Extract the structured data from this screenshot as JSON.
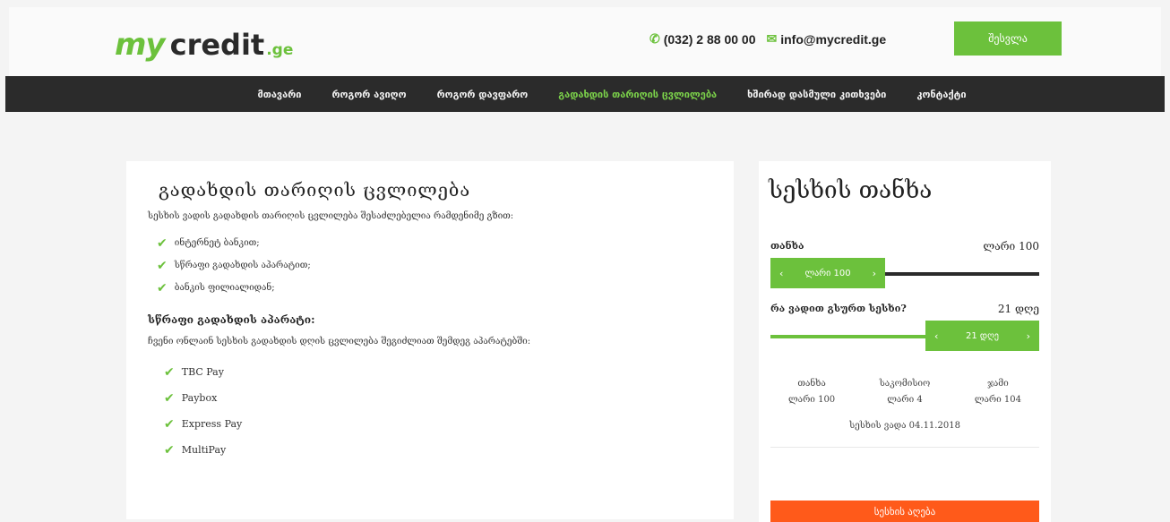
{
  "header": {
    "logo": {
      "my": "my",
      "credit": "credit",
      "ge": ".ge"
    },
    "phone": "(032) 2 88 00 00",
    "email": "info@mycredit.ge",
    "login_label": "შესვლა"
  },
  "nav": {
    "items": [
      {
        "label": "მთავარი",
        "active": false
      },
      {
        "label": "როგორ ავიღო",
        "active": false
      },
      {
        "label": "როგორ დავფარო",
        "active": false
      },
      {
        "label": "გადახდის თარიღის ცვლილება",
        "active": true
      },
      {
        "label": "ხშირად დასმული კითხვები",
        "active": false
      },
      {
        "label": "კონტაქტი",
        "active": false
      }
    ]
  },
  "main": {
    "title": "გადახდის თარიღის ცვლილება",
    "intro": "სესხის ვადის გადახდის თარიღის ცვლილება შესაძლებელია რამდენიმე გზით:",
    "methods": [
      "ინტერნეტ ბანკით;",
      "სწრაფი გადახდის აპარატით;",
      "ბანკის ფილიალიდან;"
    ],
    "terminals_title": "სწრაფი გადახდის აპარატი:",
    "terminals_intro": "ჩვენი ონლაინ სესხის გადახდის დღის ცვლილება შეგიძლიათ შემდეგ აპარატებში:",
    "terminals": [
      "TBC Pay",
      "Paybox",
      "Express Pay",
      "MultiPay"
    ]
  },
  "calculator": {
    "title": "სესხის თანხა",
    "amount_label": "თანხა",
    "amount_value": "ლარი 100",
    "amount_handle": "ლარი 100",
    "amount_fraction": 0.2,
    "term_label": "რა ვადით გსურთ სესხი?",
    "term_value": "21 დღე",
    "term_handle": "21 დღე",
    "term_fraction": 0.7,
    "summary": [
      {
        "label": "თანხა",
        "value": "ლარი 100"
      },
      {
        "label": "საკომისიო",
        "value": "ლარი 4"
      },
      {
        "label": "ჯამი",
        "value": "ლარი 104"
      }
    ],
    "due_date": "სესხის ვადა 04.11.2018",
    "submit_label": "სესხის აღება"
  },
  "colors": {
    "accent": "#6cc13c",
    "nav_bg": "#2b2b2b",
    "cta": "#ff5a1a"
  },
  "icons": {
    "phone": "phone-icon",
    "email": "envelope-icon",
    "check": "checkmark-icon"
  }
}
